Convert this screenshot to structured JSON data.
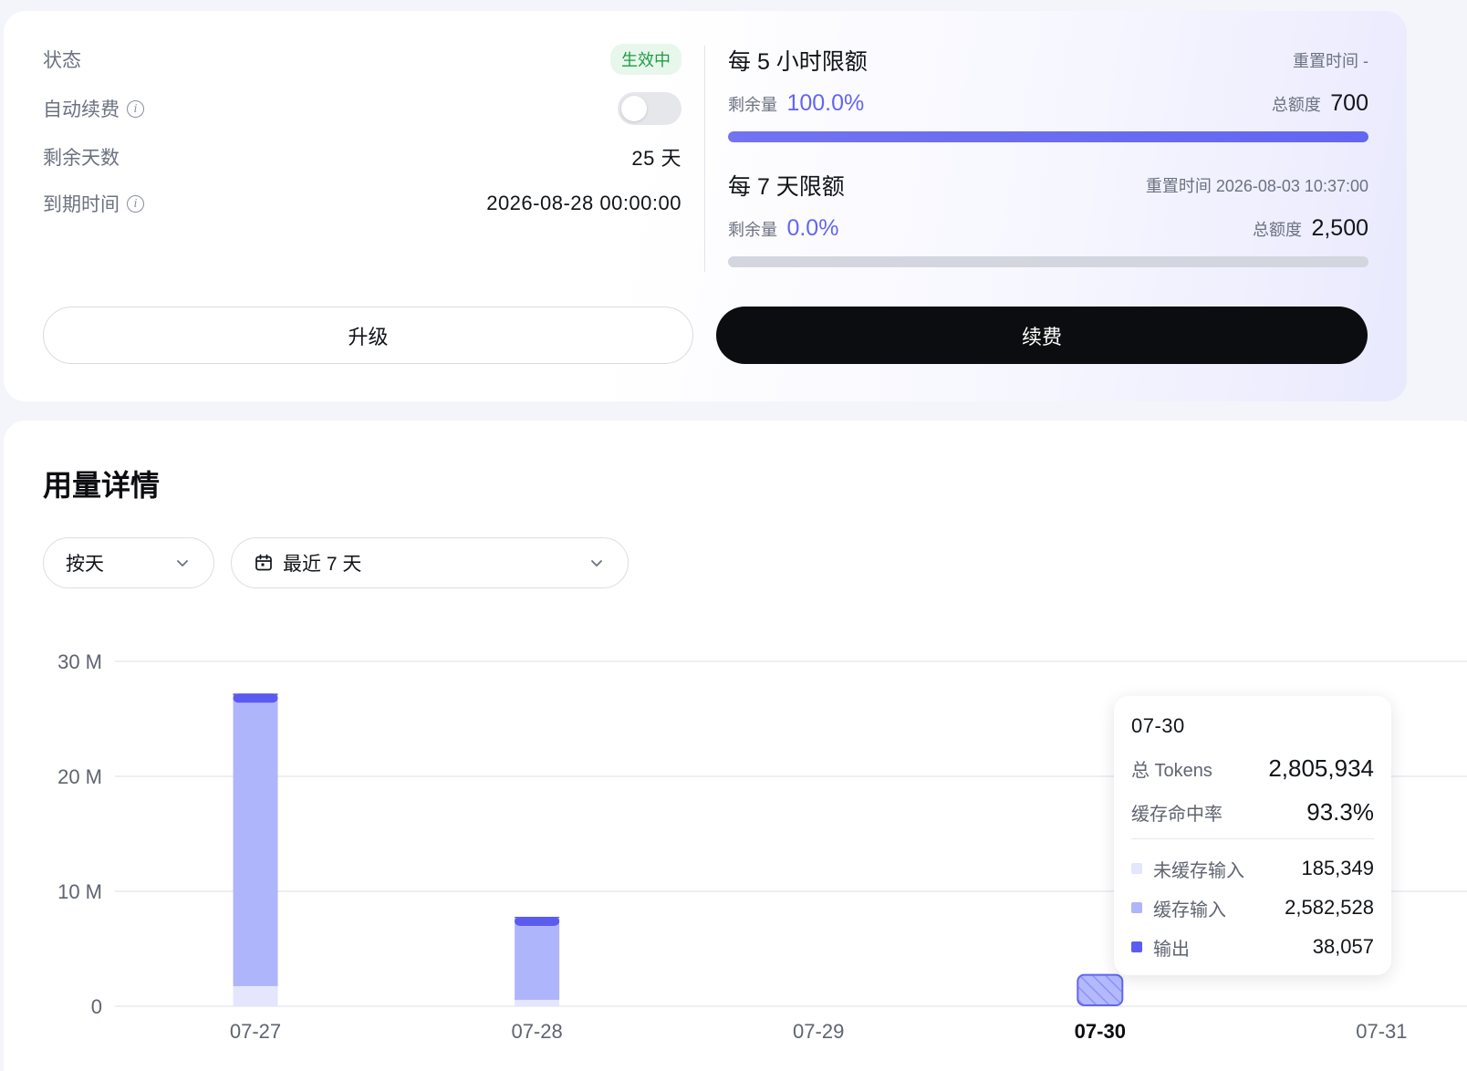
{
  "plan": {
    "status_label": "状态",
    "status_value": "生效中",
    "auto_renew_label": "自动续费",
    "auto_renew_on": false,
    "remaining_days_label": "剩余天数",
    "remaining_days_value": "25 天",
    "expiry_label": "到期时间",
    "expiry_value": "2026-08-28 00:00:00",
    "upgrade_label": "升级",
    "renew_label": "续费"
  },
  "quotas": [
    {
      "title": "每 5 小时限额",
      "reset": "重置时间 -",
      "remain_label": "剩余量",
      "remain_pct": "100.0%",
      "remain_fraction": 1.0,
      "total_label": "总额度",
      "total_value": "700"
    },
    {
      "title": "每 7 天限额",
      "reset": "重置时间 2026-08-03 10:37:00",
      "remain_label": "剩余量",
      "remain_pct": "0.0%",
      "remain_fraction": 0.0,
      "total_label": "总额度",
      "total_value": "2,500"
    }
  ],
  "usage": {
    "title": "用量详情",
    "granularity": "按天",
    "range": "最近 7 天"
  },
  "colors": {
    "accent": "#6366f1",
    "uncached_input": "#e4e6fd",
    "cached_input": "#afb5fb",
    "output": "#5b5bf0",
    "status_green": "#1f9d46"
  },
  "chart_data": {
    "type": "bar",
    "stacked": true,
    "categories": [
      "07-27",
      "07-28",
      "07-29",
      "07-30",
      "07-31"
    ],
    "active_category": "07-30",
    "ylim": [
      0,
      30000000
    ],
    "yticks": [
      {
        "value": 0,
        "label": "0"
      },
      {
        "value": 10000000,
        "label": "10 M"
      },
      {
        "value": 20000000,
        "label": "20 M"
      },
      {
        "value": 30000000,
        "label": "30 M"
      }
    ],
    "grid": true,
    "series": [
      {
        "name": "未缓存输入",
        "color": "#e4e6fd",
        "values": [
          1750000,
          550000,
          0,
          185349,
          0
        ]
      },
      {
        "name": "缓存输入",
        "color": "#afb5fb",
        "values": [
          25300000,
          7200000,
          0,
          2582528,
          0
        ]
      },
      {
        "name": "输出",
        "color": "#5b5bf0",
        "values": [
          150000,
          30000,
          0,
          38057,
          0
        ]
      }
    ],
    "tooltip": {
      "date": "07-30",
      "total_label": "总 Tokens",
      "total_value": "2,805,934",
      "hit_label": "缓存命中率",
      "hit_value": "93.3%",
      "rows": [
        {
          "label": "未缓存输入",
          "value": "185,349",
          "color": "#e4e6fd"
        },
        {
          "label": "缓存输入",
          "value": "2,582,528",
          "color": "#afb5fb"
        },
        {
          "label": "输出",
          "value": "38,057",
          "color": "#5b5bf0"
        }
      ]
    }
  }
}
